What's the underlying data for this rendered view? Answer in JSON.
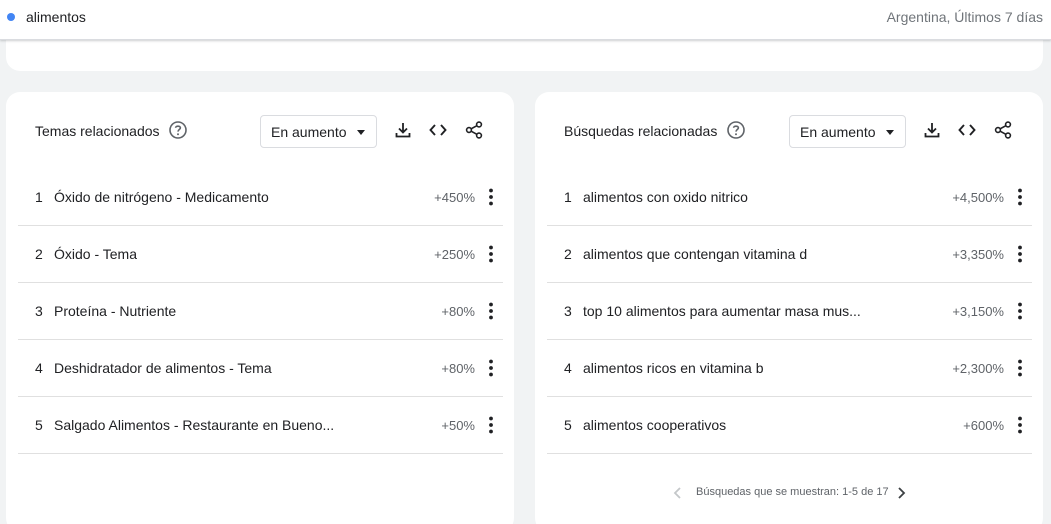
{
  "header": {
    "term": "alimentos",
    "region": "Argentina, Últimos 7 días",
    "term_color": "#4285f4"
  },
  "left_panel": {
    "title": "Temas relacionados",
    "filter": "En aumento",
    "icons": [
      "help-icon",
      "download-icon",
      "embed-code-icon",
      "share-icon"
    ],
    "rows": [
      {
        "rank": "1",
        "text": "Óxido de nitrógeno - Medicamento",
        "value": "+450%"
      },
      {
        "rank": "2",
        "text": "Óxido - Tema",
        "value": "+250%"
      },
      {
        "rank": "3",
        "text": "Proteína - Nutriente",
        "value": "+80%"
      },
      {
        "rank": "4",
        "text": "Deshidratador de alimentos - Tema",
        "value": "+80%"
      },
      {
        "rank": "5",
        "text": "Salgado Alimentos - Restaurante en Bueno...",
        "value": "+50%"
      }
    ]
  },
  "right_panel": {
    "title": "Búsquedas relacionadas",
    "filter": "En aumento",
    "icons": [
      "help-icon",
      "download-icon",
      "embed-code-icon",
      "share-icon"
    ],
    "rows": [
      {
        "rank": "1",
        "text": "alimentos con oxido nitrico",
        "value": "+4,500%"
      },
      {
        "rank": "2",
        "text": "alimentos que contengan vitamina d",
        "value": "+3,350%"
      },
      {
        "rank": "3",
        "text": "top 10 alimentos para aumentar masa mus...",
        "value": "+3,150%"
      },
      {
        "rank": "4",
        "text": "alimentos ricos en vitamina b",
        "value": "+2,300%"
      },
      {
        "rank": "5",
        "text": "alimentos cooperativos",
        "value": "+600%"
      }
    ],
    "pagination": "Búsquedas que se muestran: 1-5 de 17"
  }
}
